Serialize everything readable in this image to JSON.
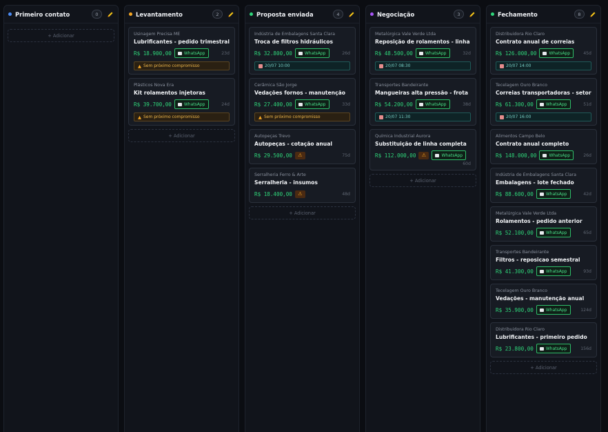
{
  "columns": [
    {
      "title": "Primeiro contato",
      "count": "0",
      "dot_color": "#4b8cf5",
      "add_label": "+ Adicionar",
      "cards": []
    },
    {
      "title": "Levantamento",
      "count": "2",
      "dot_color": "#f5a623",
      "add_label": "+ Adicionar",
      "cards": [
        {
          "company": "Usinagem Precisa ME",
          "title": "Lubrificantes - pedido trimestral",
          "value": "R$ 18.900,00",
          "whatsapp": "WhatsApp",
          "age": "23d",
          "warn": "Sem próximo compromisso"
        },
        {
          "company": "Plásticos Nova Era",
          "title": "Kit rolamentos injetoras",
          "value": "R$ 39.700,00",
          "whatsapp": "WhatsApp",
          "age": "24d",
          "warn": "Sem próximo compromisso"
        }
      ]
    },
    {
      "title": "Proposta enviada",
      "count": "4",
      "dot_color": "#2fd67a",
      "add_label": "+ Adicionar",
      "cards": [
        {
          "company": "Indústria de Embalagens Santa Clara",
          "title": "Troca de filtros hidráulicos",
          "value": "R$ 32.800,00",
          "whatsapp": "WhatsApp",
          "age": "26d",
          "date": "20/07 10:00"
        },
        {
          "company": "Cerâmica São Jorge",
          "title": "Vedações fornos - manutenção",
          "value": "R$ 27.400,00",
          "whatsapp": "WhatsApp",
          "age": "33d",
          "warn": "Sem próximo compromisso"
        },
        {
          "company": "Autopeças Trevo",
          "title": "Autopeças - cotação anual",
          "value": "R$ 29.500,00",
          "alert": "⚠",
          "age": "75d"
        },
        {
          "company": "Serralheria Ferro & Arte",
          "title": "Serralheria - insumos",
          "value": "R$ 18.400,00",
          "alert": "⚠",
          "age": "48d"
        }
      ]
    },
    {
      "title": "Negociação",
      "count": "3",
      "dot_color": "#a855f7",
      "add_label": "+ Adicionar",
      "cards": [
        {
          "company": "Metalúrgica Vale Verde Ltda",
          "title": "Reposição de rolamentos - linha 3",
          "value": "R$ 48.500,00",
          "whatsapp": "WhatsApp",
          "age": "32d",
          "date": "20/07 08:30"
        },
        {
          "company": "Transportes Bandeirante",
          "title": "Mangueiras alta pressão - frota",
          "value": "R$ 54.200,00",
          "whatsapp": "WhatsApp",
          "age": "38d",
          "date": "20/07 11:30"
        },
        {
          "company": "Química Industrial Aurora",
          "title": "Substituição de linha completa",
          "value": "R$ 112.000,00",
          "alert": "⚠",
          "whatsapp": "WhatsApp",
          "age_below": "60d"
        }
      ]
    },
    {
      "title": "Fechamento",
      "count": "8",
      "dot_color": "#2fd67a",
      "add_label": "+ Adicionar",
      "cards": [
        {
          "company": "Distribuidora Rio Claro",
          "title": "Contrato anual de correias",
          "value": "R$ 126.000,00",
          "whatsapp": "WhatsApp",
          "age": "45d",
          "date": "20/07 14:00"
        },
        {
          "company": "Tecelagem Ouro Branco",
          "title": "Correias transportadoras - setor B",
          "value": "R$ 61.300,00",
          "whatsapp": "WhatsApp",
          "age": "51d",
          "date": "20/07 16:00"
        },
        {
          "company": "Alimentos Campo Belo",
          "title": "Contrato anual completo",
          "value": "R$ 148.000,00",
          "whatsapp": "WhatsApp",
          "age": "26d"
        },
        {
          "company": "Indústria de Embalagens Santa Clara",
          "title": "Embalagens - lote fechado",
          "value": "R$ 88.600,00",
          "whatsapp": "WhatsApp",
          "age": "42d"
        },
        {
          "company": "Metalúrgica Vale Verde Ltda",
          "title": "Rolamentos - pedido anterior",
          "value": "R$ 52.100,00",
          "whatsapp": "WhatsApp",
          "age": "65d"
        },
        {
          "company": "Transportes Bandeirante",
          "title": "Filtros - reposicao semestral",
          "value": "R$ 41.300,00",
          "whatsapp": "WhatsApp",
          "age": "93d"
        },
        {
          "company": "Tecelagem Ouro Branco",
          "title": "Vedações - manutenção anual",
          "value": "R$ 35.900,00",
          "whatsapp": "WhatsApp",
          "age": "124d"
        },
        {
          "company": "Distribuidora Rio Claro",
          "title": "Lubrificantes - primeiro pedido",
          "value": "R$ 23.800,00",
          "whatsapp": "WhatsApp",
          "age": "156d"
        }
      ]
    }
  ],
  "icons": {
    "edit": "pencil-icon",
    "whatsapp": "chat-icon",
    "date": "calendar-icon",
    "warning": "warning-icon"
  }
}
